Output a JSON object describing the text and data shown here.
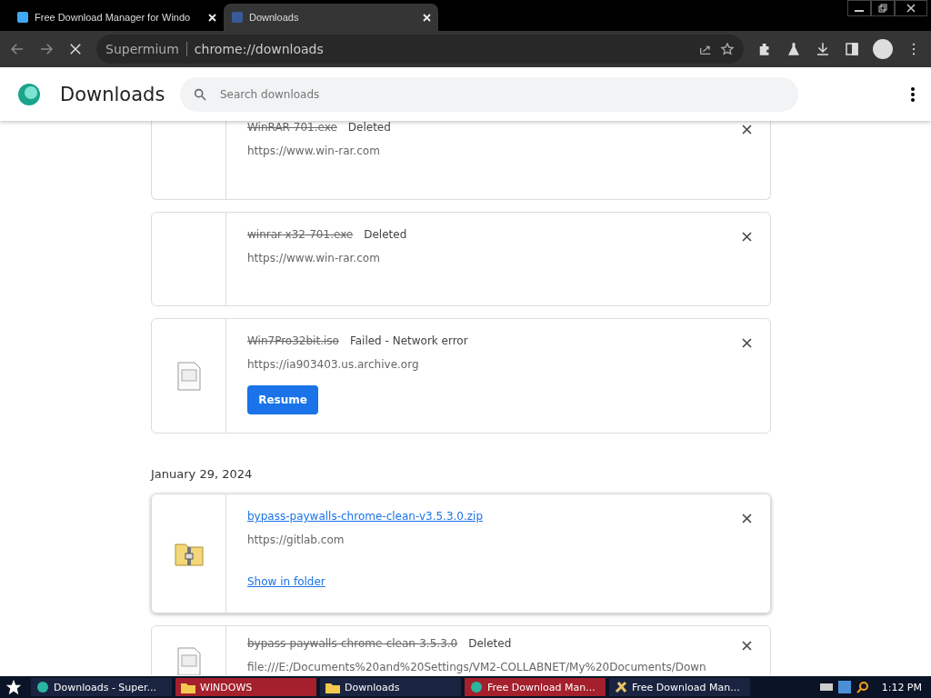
{
  "tabs": [
    {
      "title": "Free Download Manager for Windo",
      "selected": false
    },
    {
      "title": "Downloads",
      "selected": true
    }
  ],
  "address_bar": {
    "brand": "Supermium",
    "url": "chrome://downloads"
  },
  "page": {
    "title": "Downloads",
    "search": {
      "placeholder": "Search downloads"
    }
  },
  "downloads": [
    {
      "kind": "deleted",
      "file": "WinRAR-701.exe",
      "status": "Deleted",
      "source": "https://www.win-rar.com"
    },
    {
      "kind": "deleted",
      "file": "winrar-x32-701.exe",
      "status": "Deleted",
      "source": "https://www.win-rar.com"
    },
    {
      "kind": "failed",
      "file": "Win7Pro32bit.iso",
      "status": "Failed - Network error",
      "source": "https://ia903403.us.archive.org",
      "action": "Resume"
    },
    {
      "kind": "date",
      "label": "January 29, 2024"
    },
    {
      "kind": "complete",
      "file": "bypass-paywalls-chrome-clean-v3.5.3.0.zip",
      "source": "https://gitlab.com",
      "action": "Show in folder"
    },
    {
      "kind": "deleted",
      "file": "bypass-paywalls-chrome-clean-3.5.3.0",
      "status": "Deleted",
      "source": "file:///E:/Documents%20and%20Settings/VM2-COLLABNET/My%20Documents/Down"
    }
  ],
  "taskbar": {
    "items": [
      {
        "label": "Downloads - Super...",
        "flashing": false
      },
      {
        "label": "WINDOWS",
        "flashing": true
      },
      {
        "label": "Downloads",
        "flashing": false
      },
      {
        "label": "Free Download Man...",
        "flashing": true
      },
      {
        "label": "Free Download Man...",
        "flashing": false
      }
    ],
    "clock": "1:12 PM"
  }
}
